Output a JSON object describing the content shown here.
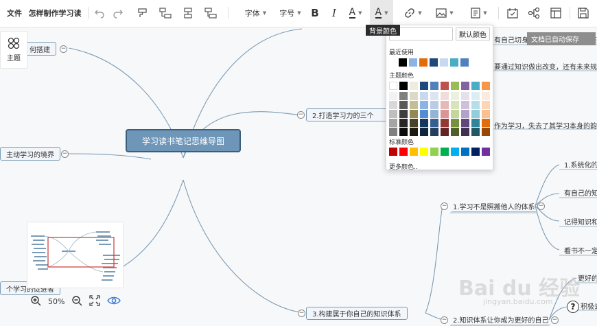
{
  "toolbar": {
    "file_label": "文件",
    "doc_title": "怎样制作学习读",
    "font_label": "字体",
    "fontsize_label": "字号",
    "bold_glyph": "B",
    "italic_glyph": "I",
    "fontcolor_glyph": "A",
    "bgcolor_glyph": "A"
  },
  "tooltip": {
    "text": "背景颜色"
  },
  "toast": {
    "text": "文档已自动保存"
  },
  "theme_button": {
    "label": "主题"
  },
  "zoom": {
    "value": "50%"
  },
  "root": {
    "label": "学习读书笔记思维导图"
  },
  "left_nodes": [
    "何搭建",
    "主动学习的境界",
    "个学习的促进者"
  ],
  "branches": {
    "b2": "2.打造学习力的三个",
    "b3": "3.构建属于你自己的知识体系"
  },
  "sub_nodes": {
    "s1": "1.学习不是照搬他人的体系",
    "s2": "2.知识体系让你成为更好的自己"
  },
  "right_texts": [
    "有自己切身的经历，才能形成便签",
    "要通过知识做出改变，还有未来规划",
    "作为学习，失去了其学习本身的韵味",
    "1.系统化的",
    "有自己的知",
    "记得知识和",
    "看书不一定",
    "更好的",
    "积极去"
  ],
  "popover": {
    "no_color_label": "默认颜色",
    "recent_title": "最近使用",
    "theme_title": "主题颜色",
    "standard_title": "标准颜色",
    "more_label": "更多颜色..",
    "recent_colors": [
      "#000000",
      "#8db3e2",
      "#e36c09",
      "#1f497d",
      "#c6d9f0",
      "#4bacc6",
      "#4f81bd"
    ],
    "theme_colors": [
      [
        "#ffffff",
        "#000000",
        "#eeece1",
        "#1f497d",
        "#4f81bd",
        "#c0504d",
        "#9bbb59",
        "#8064a2",
        "#4bacc6",
        "#f79646"
      ],
      [
        "#f2f2f2",
        "#7f7f7f",
        "#ddd9c3",
        "#c6d9f0",
        "#dbe5f1",
        "#f2dcdb",
        "#ebf1dd",
        "#e5e0ec",
        "#dbeef3",
        "#fdeada"
      ],
      [
        "#d8d8d8",
        "#595959",
        "#c4bd97",
        "#8db3e2",
        "#b8cce4",
        "#e5b9b7",
        "#d7e3bc",
        "#ccc1d9",
        "#b7dde8",
        "#fbd5b5"
      ],
      [
        "#bfbfbf",
        "#3f3f3f",
        "#938953",
        "#548dd4",
        "#95b3d7",
        "#d99694",
        "#c3d69b",
        "#b2a2c7",
        "#92cddc",
        "#fac08f"
      ],
      [
        "#a5a5a5",
        "#262626",
        "#494429",
        "#17365d",
        "#366092",
        "#953734",
        "#76923c",
        "#5f497a",
        "#31859b",
        "#e36c09"
      ],
      [
        "#7f7f7f",
        "#0c0c0c",
        "#1d1b10",
        "#0f243e",
        "#244061",
        "#632423",
        "#4f6128",
        "#3f3151",
        "#205867",
        "#974806"
      ]
    ],
    "standard_colors": [
      "#c00000",
      "#ff0000",
      "#ffc000",
      "#ffff00",
      "#92d050",
      "#00b050",
      "#00b0f0",
      "#0070c0",
      "#002060",
      "#7030a0"
    ]
  },
  "watermark": {
    "main": "Bai du 经验",
    "sub": "jingyan.baidu.com"
  },
  "help": {
    "glyph": "?"
  }
}
